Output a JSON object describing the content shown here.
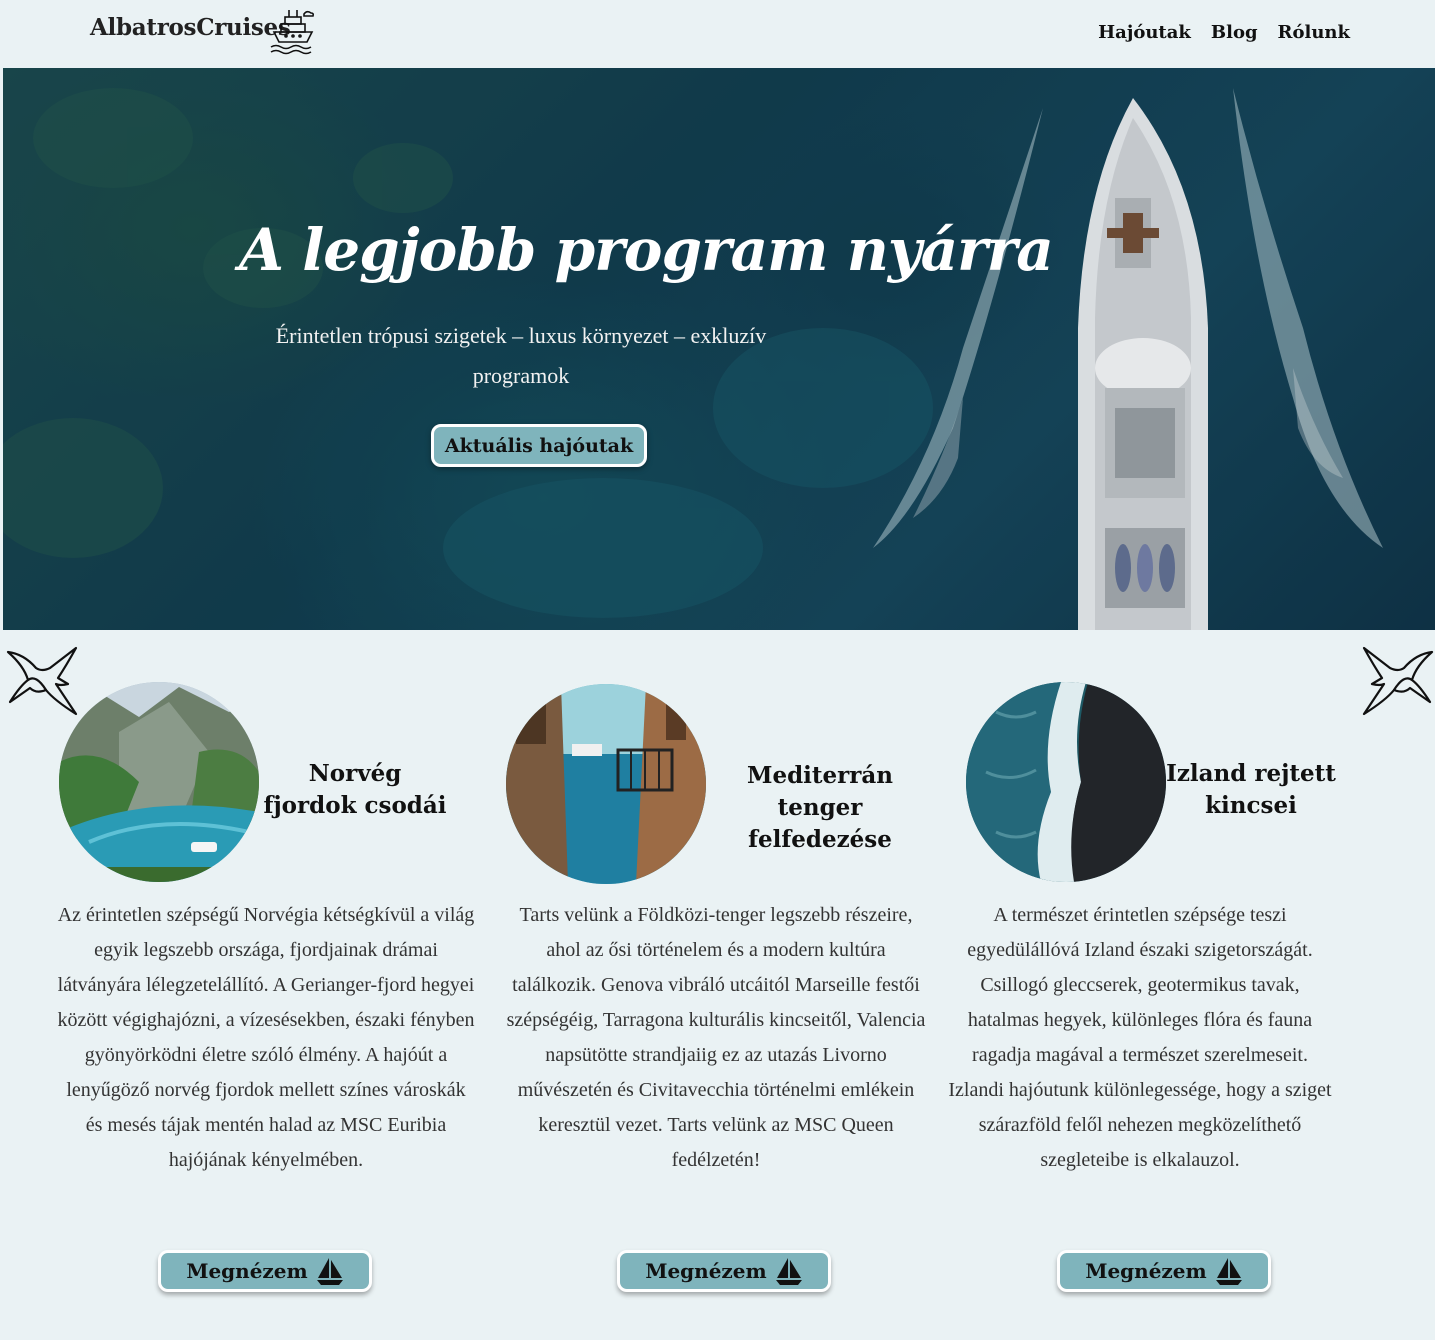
{
  "header": {
    "brand": "AlbatrosCruises",
    "nav": [
      "Hajóutak",
      "Blog",
      "Rólunk"
    ]
  },
  "hero": {
    "title": "A legjobb program nyárra",
    "subtitle": "Érintetlen trópusi szigetek – luxus környezet – exkluzív programok",
    "button": "Aktuális hajóutak"
  },
  "cards": [
    {
      "title": "Norvég fjordok csodái",
      "text": "Az érintetlen szépségű Norvégia kétségkívül a világ egyik legszebb országa, fjordjainak drámai látványára lélegzetelállító. A Gerianger-fjord hegyei között végighajózni, a vízesésekben, északi fényben gyönyörködni életre szóló élmény. A hajóút a lenyűgöző norvég fjordok mellett színes városkák és mesés tájak mentén halad az MSC Euribia hajójának kényelmében.",
      "button": "Megnézem"
    },
    {
      "title": "Mediterrán tenger felfedezése",
      "text": "Tarts velünk a Földközi-tenger legszebb részeire, ahol az ősi történelem és a modern kultúra találkozik. Genova vibráló utcáitól Marseille festői szépségéig, Tarragona kulturális kincseitől, Valencia napsütötte strandjaiig ez az utazás Livorno művészetén és Civitavecchia történelmi emlékein keresztül vezet. Tarts velünk az MSC Queen fedélzetén!",
      "button": "Megnézem"
    },
    {
      "title": "Izland rejtett kincsei",
      "text": "A természet érintetlen szépsége teszi egyedülállóvá Izland északi szigetországát. Csillogó gleccserek, geotermikus tavak, hatalmas hegyek, különleges flóra és fauna ragadja magával a természet szerelmeseit. Izlandi hajóutunk különlegessége, hogy a sziget szárazföld felől nehezen megközelíthető szegleteibe is elkalauzol.",
      "button": "Megnézem"
    }
  ],
  "colors": {
    "background": "#eaf2f4",
    "button": "#7fb4bc",
    "hero_sea": "#16475d"
  },
  "icons": [
    "cruise-ship-logo-icon",
    "albatross-icon",
    "sailboat-icon"
  ]
}
